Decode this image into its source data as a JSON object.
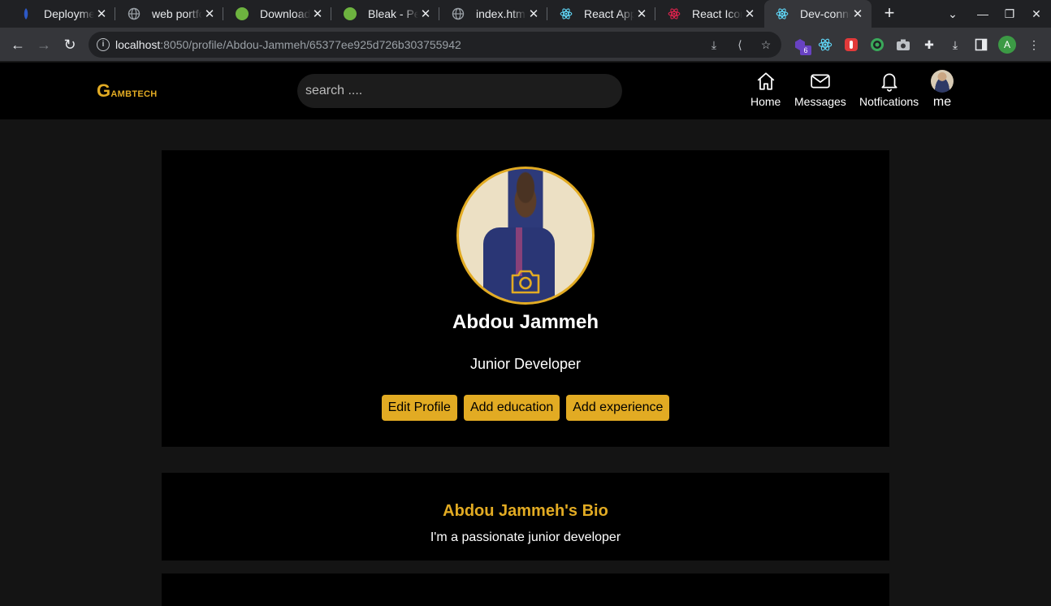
{
  "browser": {
    "tabs": [
      {
        "title": "Deployment",
        "icon": "deploy-icon",
        "color": "#2d59c6"
      },
      {
        "title": "web portfolio",
        "icon": "globe-icon",
        "color": "#9aa0a6"
      },
      {
        "title": "Download",
        "icon": "leaf-icon",
        "color": "#6db33f"
      },
      {
        "title": "Bleak - Personal",
        "icon": "leaf-icon",
        "color": "#6db33f"
      },
      {
        "title": "index.html",
        "icon": "globe-icon",
        "color": "#9aa0a6"
      },
      {
        "title": "React App",
        "icon": "react-icon",
        "color": "#61dafb"
      },
      {
        "title": "React Icons",
        "icon": "react-icon",
        "color": "#e0234e"
      },
      {
        "title": "Dev-connector",
        "icon": "react-icon",
        "color": "#61dafb"
      }
    ],
    "active_tab": 7,
    "url_host": "localhost",
    "url_rest": ":8050/profile/Abdou-Jammeh/65377ee925d726b303755942",
    "extension_badge": "6",
    "profile_initial": "A"
  },
  "header": {
    "logo_first": "G",
    "logo_rest": "ambtech",
    "search_placeholder": "search ....",
    "nav": {
      "home": "Home",
      "messages": "Messages",
      "notifications": "Notfications",
      "me": "me"
    }
  },
  "profile": {
    "name": "Abdou Jammeh",
    "role": "Junior Developer",
    "buttons": {
      "edit": "Edit Profile",
      "education": "Add education",
      "experience": "Add experience"
    }
  },
  "bio": {
    "title": "Abdou Jammeh's Bio",
    "text": "I'm a passionate junior developer"
  },
  "colors": {
    "accent": "#e2ab23",
    "background": "#141414",
    "card": "#000000"
  }
}
